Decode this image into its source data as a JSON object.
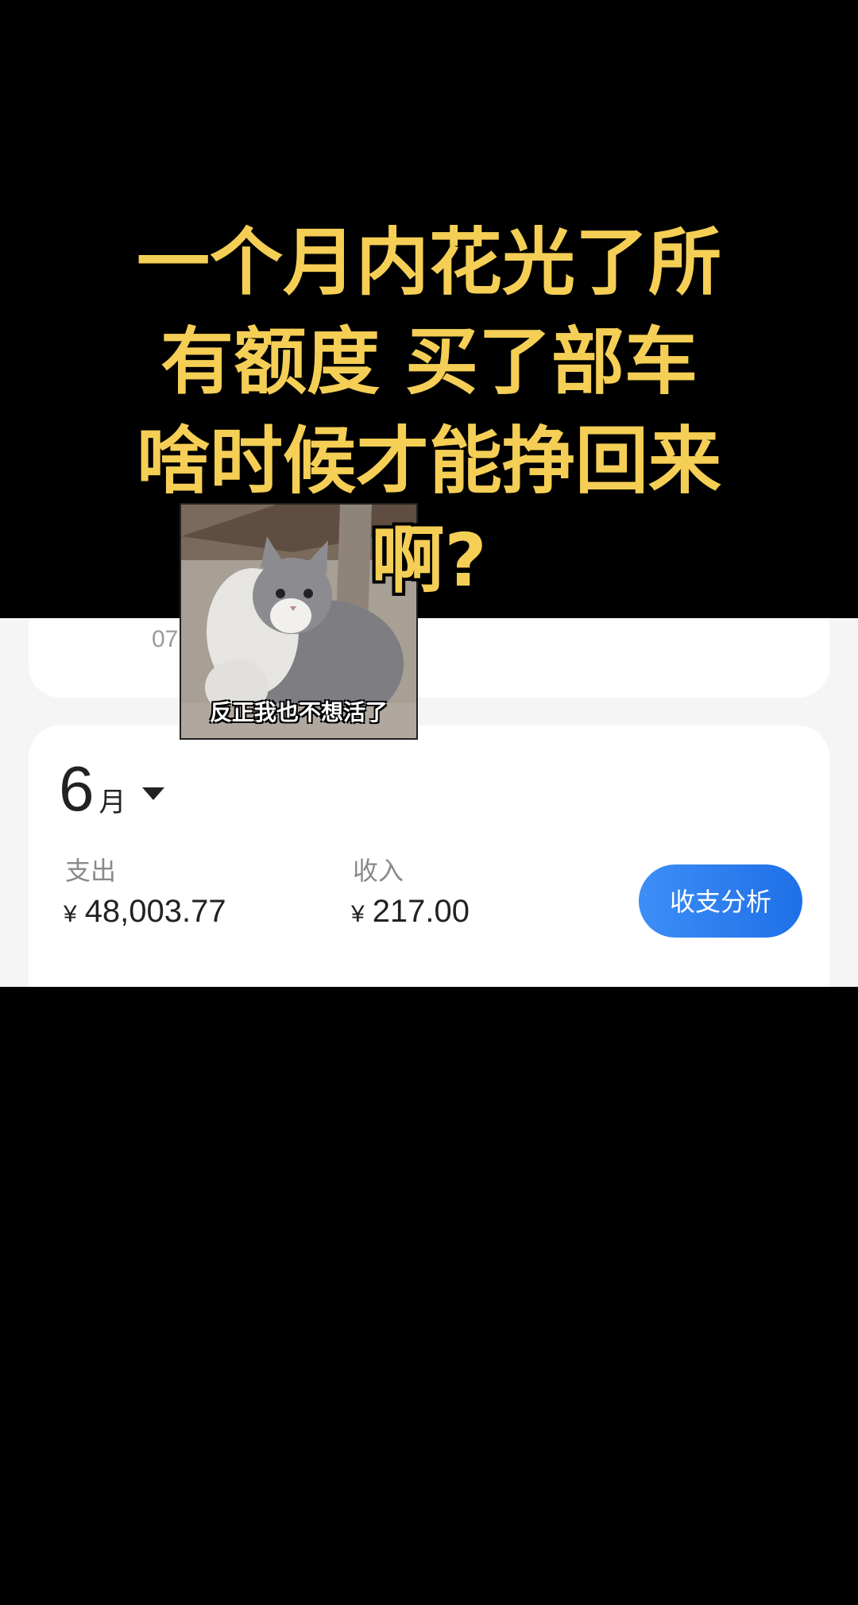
{
  "caption": {
    "lines": [
      "一个月内花光了所",
      "有额度 买了部车",
      "啥时候才能挣回来",
      "啊?"
    ],
    "color": "#f5cf55"
  },
  "meme": {
    "caption": "反正我也不想活了"
  },
  "prev_card": {
    "date_fragment": "07"
  },
  "month_card": {
    "month_number": "6",
    "month_unit": "月",
    "expense": {
      "label": "支出",
      "currency": "¥",
      "amount": "48,003.77"
    },
    "income": {
      "label": "收入",
      "currency": "¥",
      "amount": "217.00"
    },
    "analysis_button": "收支分析",
    "accent_color": "#2a7df0"
  }
}
